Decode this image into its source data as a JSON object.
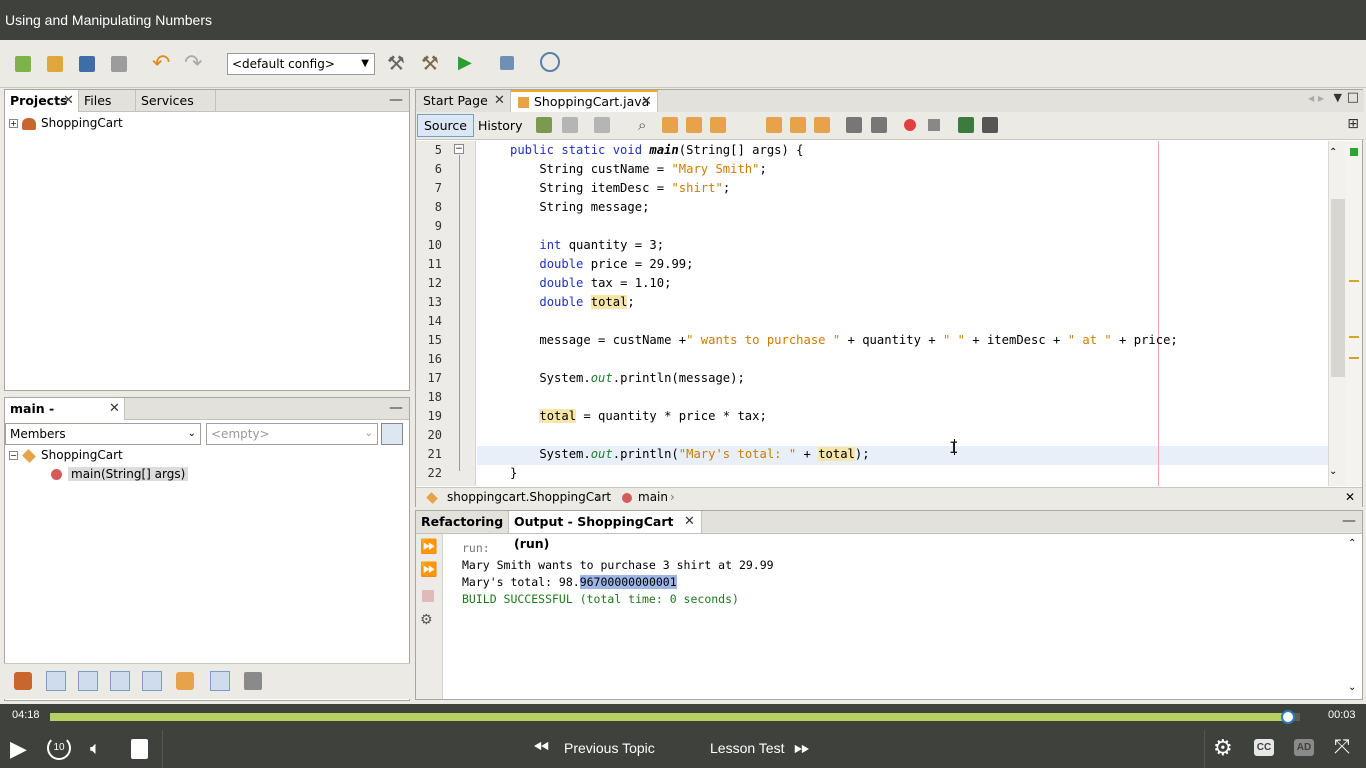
{
  "course_title": "Using and Manipulating Numbers",
  "toolbar": {
    "config_value": "<default config>"
  },
  "projects_panel": {
    "tabs": [
      "Projects",
      "Files",
      "Services"
    ],
    "tree": [
      {
        "label": "ShoppingCart"
      }
    ]
  },
  "navigator_panel": {
    "title": "main - Navigator",
    "filter_select": "Members",
    "empty_select": "<empty>",
    "tree": [
      {
        "label": "ShoppingCart"
      },
      {
        "label": "main(String[] args)"
      }
    ]
  },
  "editor": {
    "tabs": [
      {
        "label": "Start Page"
      },
      {
        "label": "ShoppingCart.java"
      }
    ],
    "source_label": "Source",
    "history_label": "History",
    "line_numbers": [
      "5",
      "6",
      "7",
      "8",
      "9",
      "10",
      "11",
      "12",
      "13",
      "14",
      "15",
      "16",
      "17",
      "18",
      "19",
      "20",
      "21",
      "22"
    ],
    "breadcrumb": [
      "shoppingcart.ShoppingCart",
      "main"
    ]
  },
  "output_panel": {
    "tabs": [
      "Refactoring",
      "Output - ShoppingCart (run)"
    ],
    "lines": {
      "run": "run:",
      "line1": "Mary Smith wants to purchase 3 shirt at 29.99",
      "line2_prefix": "Mary's total: 98.",
      "line2_selected": "96700000000001",
      "build": "BUILD SUCCESSFUL (total time: 0 seconds)"
    }
  },
  "player": {
    "elapsed": "04:18",
    "remaining": "00:03",
    "progress_fraction": 0.99,
    "skip_back_label": "10",
    "prev_label": "Previous Topic",
    "next_label": "Lesson Test",
    "cc_label": "CC",
    "ad_label": "AD"
  },
  "colors": {
    "keyword": "#2131c2",
    "string": "#ce7b00",
    "progress": "#b6d061",
    "build_success": "#1a7a1a"
  }
}
